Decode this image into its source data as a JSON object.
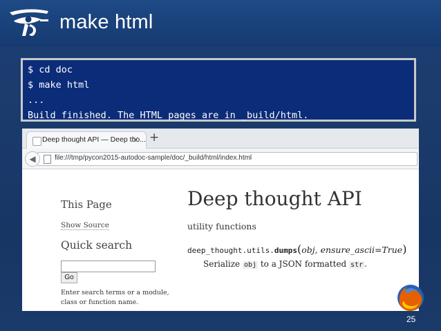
{
  "slide": {
    "title": "make html",
    "page_number": "25",
    "logo_icon": "eye-of-horus-icon",
    "firefox_icon": "firefox-logo-icon"
  },
  "terminal": {
    "lines": [
      "$ cd doc",
      "$ make html",
      "...",
      "Build finished. The HTML pages are in _build/html."
    ]
  },
  "browser": {
    "tab_label": "Deep thought API — Deep tho...",
    "tab_close": "×",
    "new_tab": "+",
    "url": "file:///tmp/pycon2015-autodoc-sample/doc/_build/html/index.html"
  },
  "page": {
    "sidebar": {
      "this_page": "This Page",
      "show_source": "Show Source",
      "quick_search": "Quick search",
      "search_value": "",
      "go_label": "Go",
      "hint": "Enter search terms or a module, class or function name."
    },
    "main": {
      "title": "Deep thought API",
      "subtitle": "utility functions",
      "sig_module": "deep_thought.utils.",
      "sig_name": "dumps",
      "sig_open": "(",
      "sig_args": "obj, ensure_ascii=True",
      "sig_close": ")",
      "desc_1": "Serialize ",
      "desc_code_1": "obj",
      "desc_2": " to a JSON formatted ",
      "desc_code_2": "str",
      "desc_3": "."
    }
  }
}
